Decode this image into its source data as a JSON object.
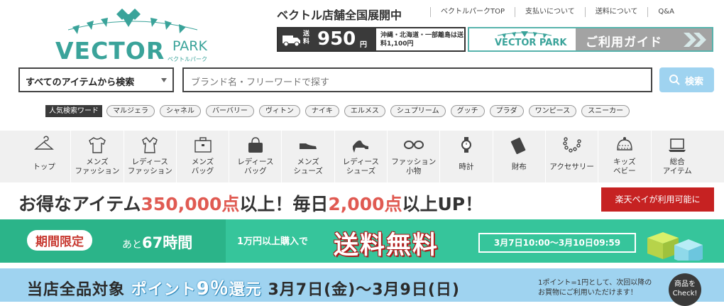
{
  "brand": {
    "name": "VECTOR",
    "park": "PARK",
    "kana": "ベクトルパーク"
  },
  "header": {
    "tagline": "ベクトル店舗全国展開中",
    "links": [
      "ベクトルパークTOP",
      "支払いについて",
      "送料について",
      "Q&A"
    ],
    "shipping": {
      "label": "送料",
      "price": "950",
      "unit": "円",
      "note": "沖縄・北海道・一部離島は送料1,100円"
    },
    "guide": {
      "brand": "VECTOR PARK",
      "label": "ご利用ガイド"
    }
  },
  "search": {
    "category": "すべてのアイテムから検索",
    "placeholder": "ブランド名・フリーワードで探す",
    "button": "検索"
  },
  "popular": {
    "label": "人気検索ワード",
    "keywords": [
      "マルジェラ",
      "シャネル",
      "バーバリー",
      "ヴィトン",
      "ナイキ",
      "エルメス",
      "シュプリーム",
      "グッチ",
      "プラダ",
      "ワンピース",
      "スニーカー"
    ]
  },
  "categories": [
    {
      "label": "トップ",
      "icon": "hanger-icon"
    },
    {
      "label": "メンズ\nファッション",
      "icon": "tshirt-icon"
    },
    {
      "label": "レディース\nファッション",
      "icon": "blouse-icon"
    },
    {
      "label": "メンズ\nバッグ",
      "icon": "briefcase-icon"
    },
    {
      "label": "レディース\nバッグ",
      "icon": "handbag-icon"
    },
    {
      "label": "メンズ\nシューズ",
      "icon": "dress-shoe-icon"
    },
    {
      "label": "レディース\nシューズ",
      "icon": "heel-icon"
    },
    {
      "label": "ファッション\n小物",
      "icon": "glasses-icon"
    },
    {
      "label": "時計",
      "icon": "watch-icon"
    },
    {
      "label": "財布",
      "icon": "wallet-icon"
    },
    {
      "label": "アクセサリー",
      "icon": "necklace-icon"
    },
    {
      "label": "キッズ\nベビー",
      "icon": "baby-hat-icon"
    },
    {
      "label": "総合\nアイテム",
      "icon": "laptop-icon"
    }
  ],
  "promo": {
    "p1": "お得なアイテム",
    "count": "350,000点",
    "p2": "以上！毎日",
    "daily": "2,000点",
    "p3": "以上UP！",
    "rakuten": "楽天ペイが利用可能に"
  },
  "freeship": {
    "limited": "期間限定",
    "remain_prefix": "あと",
    "remain_value": "67時間",
    "condition": "1万円以上購入で",
    "headline": "送料無料",
    "period": "3月7日10:00〜3月10日09:59"
  },
  "points": {
    "a": "当店全品対象",
    "b": "ポイント",
    "rate": "9％",
    "c": "還元",
    "dates": "3月7日(金)〜3月9日(日)",
    "note1": "1ポイント=1円として、次回以降の",
    "note2": "お買物にご利用いただけます！",
    "check1": "商品を",
    "check2": "Check!"
  },
  "colors": {
    "brand": "#3aa39a",
    "accent_red": "#e05a52",
    "rakuten": "#c62222",
    "green": "#36c59b",
    "blue": "#9fd3f0"
  }
}
